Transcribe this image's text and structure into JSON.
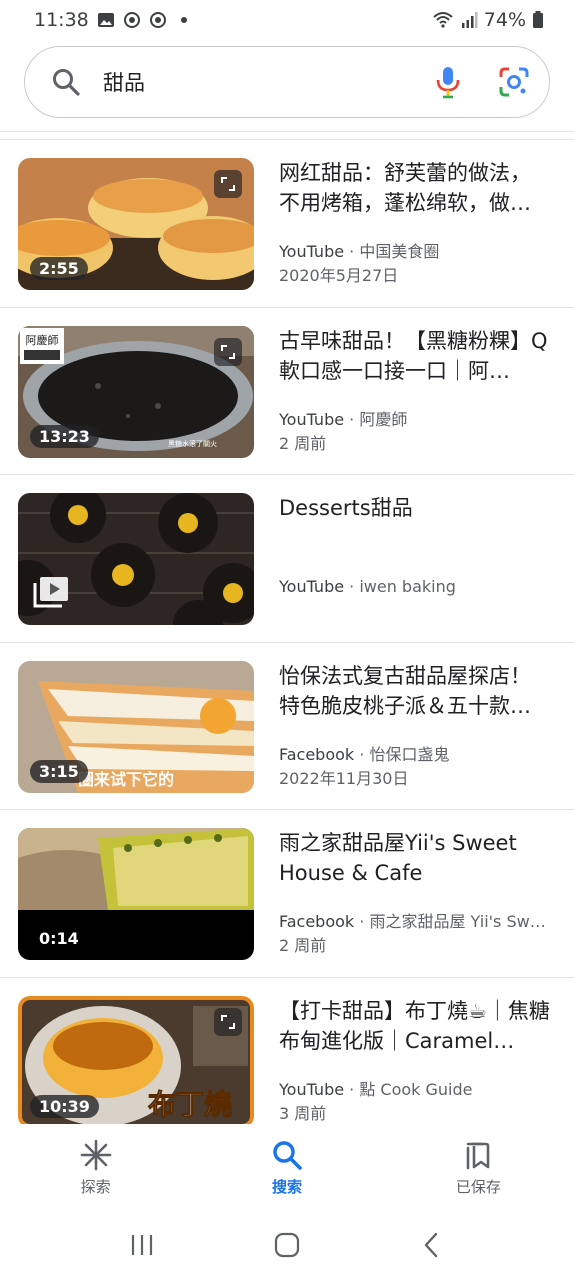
{
  "status_bar": {
    "time": "11:38",
    "battery": "74%"
  },
  "search": {
    "query": "甜品"
  },
  "results": [
    {
      "title": "网红甜品：舒芙蕾的做法，不用烤箱，蓬松绵软，做…",
      "source": "YouTube",
      "channel": "中国美食圈",
      "date": "2020年5月27日",
      "duration": "2:55",
      "thumb_theme": "souffle"
    },
    {
      "title": "古早味甜品！【黑糖粉粿】Q軟口感一口接一口｜阿…",
      "source": "YouTube",
      "channel": "阿慶師",
      "date": "2 周前",
      "duration": "13:23",
      "thumb_theme": "pot"
    },
    {
      "title": "Desserts甜品",
      "source": "YouTube",
      "channel": "iwen baking",
      "date": "",
      "duration": "",
      "thumb_theme": "donuts"
    },
    {
      "title": "怡保法式复古甜品屋探店！特色脆皮桃子派＆五十款…",
      "source": "Facebook",
      "channel": "怡保口盏鬼",
      "date": "2022年11月30日",
      "duration": "3:15",
      "thumb_theme": "millefeuille"
    },
    {
      "title": "雨之家甜品屋Yii's Sweet House & Cafe",
      "source": "Facebook",
      "channel": "雨之家甜品屋 Yii's Sw…",
      "date": "2 周前",
      "duration": "0:14",
      "thumb_theme": "durian"
    },
    {
      "title": "【打卡甜品】布丁燒☕｜焦糖布甸進化版｜Caramel…",
      "source": "YouTube",
      "channel": "點 Cook Guide",
      "date": "3 周前",
      "duration": "10:39",
      "thumb_theme": "pudding"
    }
  ],
  "bottom_nav": {
    "explore": "探索",
    "search": "搜索",
    "saved": "已保存"
  },
  "colors": {
    "accent": "#1a73e8",
    "text_primary": "#202124",
    "text_secondary": "#5f6368"
  }
}
